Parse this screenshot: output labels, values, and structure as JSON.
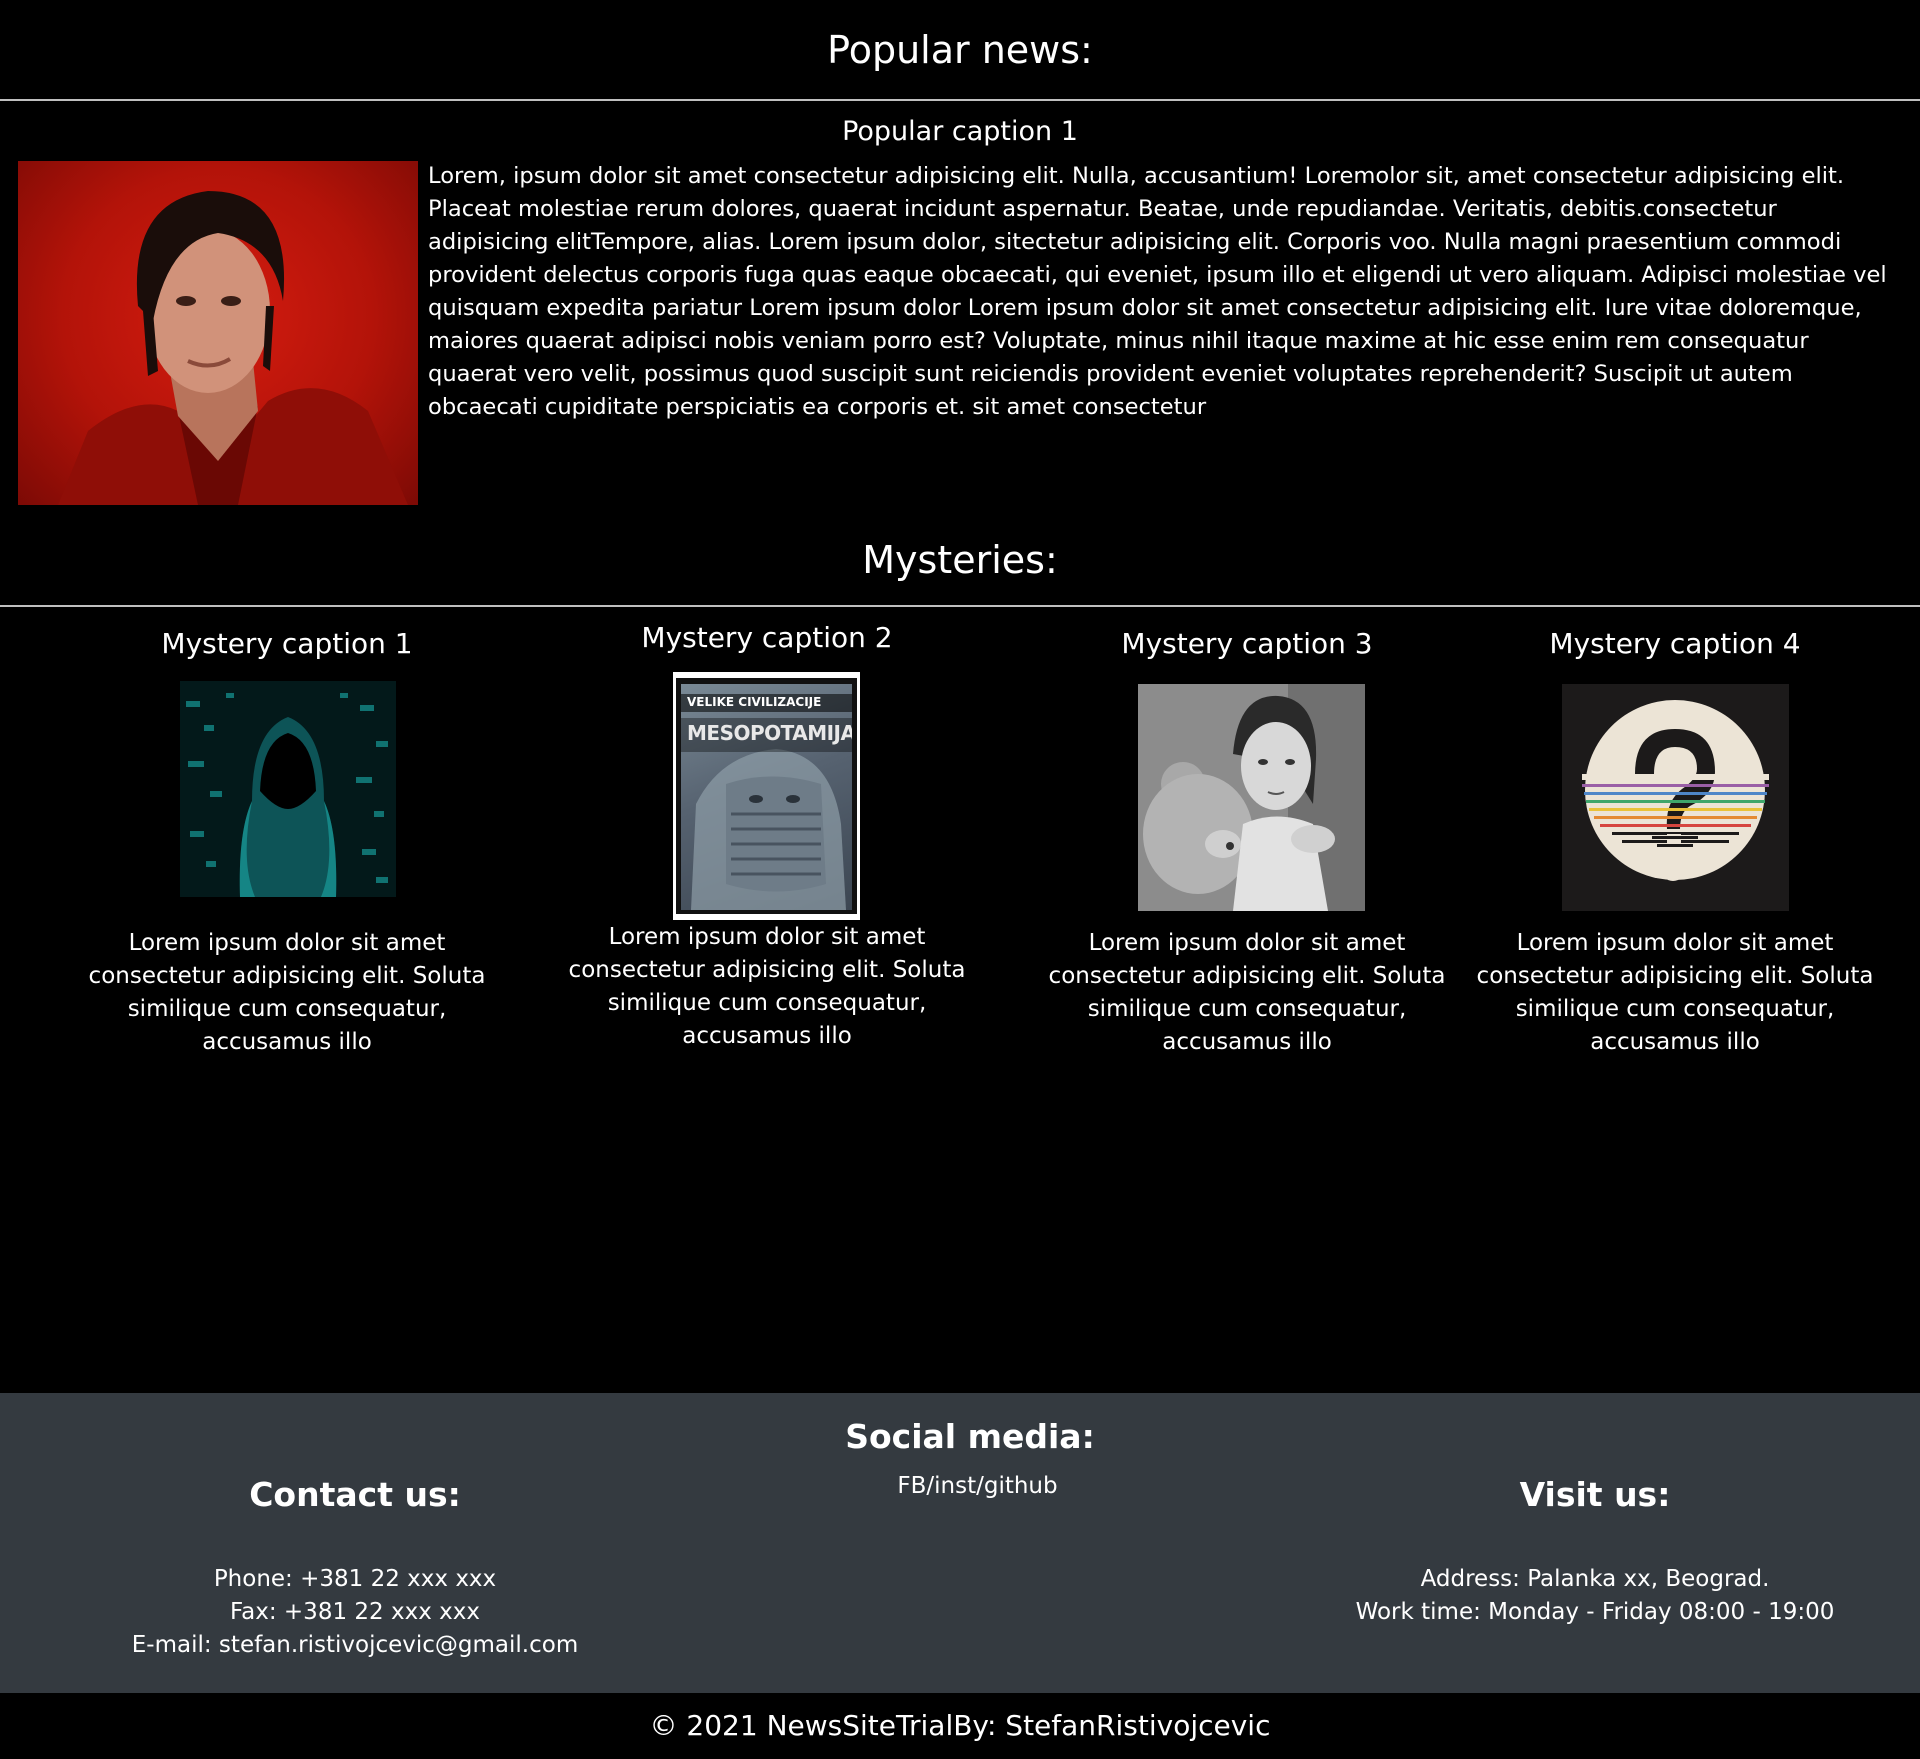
{
  "popular": {
    "title": "Popular news:",
    "caption": "Popular caption 1",
    "text": "Lorem, ipsum dolor sit amet consectetur adipisicing elit. Nulla, accusantium! Loremolor sit, amet consectetur adipisicing elit. Placeat molestiae rerum dolores, quaerat incidunt aspernatur. Beatae, unde repudiandae. Veritatis, debitis.consectetur adipisicing elitTempore, alias. Lorem ipsum dolor, sitectetur adipisicing elit. Corporis voo. Nulla magni praesentium commodi provident delectus corporis fuga quas eaque obcaecati, qui eveniet, ipsum illo et eligendi ut vero aliquam. Adipisci molestiae vel quisquam expedita pariatur Lorem ipsum dolor Lorem ipsum dolor sit amet consectetur adipisicing elit. Iure vitae doloremque, maiores quaerat adipisci nobis veniam porro est? Voluptate, minus nihil itaque maxime at hic esse enim rem consequatur quaerat vero velit, possimus quod suscipit sunt reiciendis provident eveniet voluptates reprehenderit? Suscipit ut autem obcaecati cupiditate perspiciatis ea corporis et. sit amet consectetur"
  },
  "mysteries": {
    "title": "Mysteries:",
    "items": [
      {
        "caption": "Mystery caption 1",
        "text": "Lorem ipsum dolor sit amet consectetur adipisicing elit. Soluta similique cum consequatur, accusamus illo"
      },
      {
        "caption": "Mystery caption 2",
        "text": "Lorem ipsum dolor sit amet consectetur adipisicing elit. Soluta similique cum consequatur, accusamus illo",
        "cover_kicker": "VELIKE CIVILIZACIJE",
        "cover_title": "MESOPOTAMIJA"
      },
      {
        "caption": "Mystery caption 3",
        "text": "Lorem ipsum dolor sit amet consectetur adipisicing elit. Soluta similique cum consequatur, accusamus illo"
      },
      {
        "caption": "Mystery caption 4",
        "text": "Lorem ipsum dolor sit amet consectetur adipisicing elit. Soluta similique cum consequatur, accusamus illo"
      }
    ]
  },
  "footer": {
    "contact": {
      "title": "Contact us:",
      "phone": "Phone: +381 22 xxx xxx",
      "fax": "Fax: +381 22 xxx xxx",
      "email": "E-mail: stefan.ristivojcevic@gmail.com"
    },
    "social": {
      "title": "Social media:",
      "links": "FB/inst/github"
    },
    "visit": {
      "title": "Visit us:",
      "address": "Address: Palanka xx, Beograd.",
      "hours": "Work time: Monday - Friday 08:00 - 19:00"
    },
    "background": "#343a40"
  },
  "copyright": "© 2021 NewsSiteTrialBy: StefanRistivojcevic"
}
